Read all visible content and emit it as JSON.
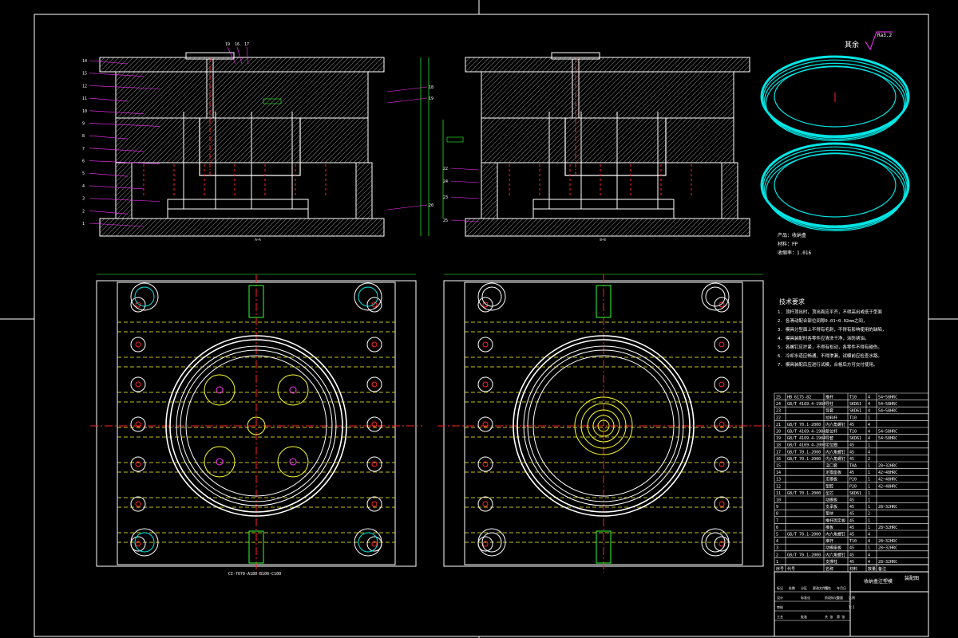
{
  "drawing": {
    "colors": {
      "line": "#ffffff",
      "hatch": "#7a7a7a",
      "leader": "#ff33ff",
      "center": "#ff2222",
      "dim": "#33ff33",
      "cyan": "#00e5e5",
      "yellow": "#ffff33"
    },
    "roughness": "Ra3.2",
    "roughness_prefix": "其余",
    "section_views": {
      "left_caption": "A—A",
      "right_caption": "B—B",
      "callouts_left_top": [
        "19",
        "16",
        "17"
      ],
      "callouts_left_side": [
        "14",
        "15",
        "12",
        "11",
        "10",
        "9",
        "8",
        "7",
        "6",
        "5",
        "4",
        "3",
        "2",
        "1"
      ],
      "callouts_left_right": [
        "18",
        "19",
        "20"
      ],
      "callouts_right_side": [
        "22",
        "24",
        "23",
        "25"
      ]
    },
    "plan_label": "CI-7070-A180-B100-C100",
    "product": {
      "name_label": "产品：",
      "name": "收纳盒",
      "material_label": "材料：",
      "material": "PP",
      "shrink_label": "收缩率：",
      "shrink": "1.016"
    },
    "tech_req": {
      "title": "技术要求",
      "lines": [
        "1. 顶杆顶出时，顶出面应平齐，不得高出或低于型面",
        "2. 各滑动配合部位间隙0.01~0.02mm之间，",
        "3. 模具分型面上不得有毛刺，不得有影响使用的缺陷，",
        "4. 模具装配时各零件应清洗干净，涂防锈油。",
        "5. 各螺钉应拧紧，不得有松动，各零件不得有碰伤。",
        "6. 冷却水道应畅通，不得渗漏，试模前应检查水路。",
        "7. 模具装配后应进行试模，合格后方可交付使用。"
      ]
    },
    "bom": {
      "rows": [
        [
          "25",
          "HB 6175-82",
          "推杆",
          "T10",
          "4",
          "54~58HRC"
        ],
        [
          "24",
          "GB/T 4169.4-1984",
          "导柱",
          "SKD61",
          "4",
          "54~58HRC"
        ],
        [
          "23",
          "",
          "导套",
          "SKD61",
          "4",
          "54~58HRC"
        ],
        [
          "22",
          "",
          "拉料杆",
          "T10",
          "1",
          ""
        ],
        [
          "21",
          "GB/T 70.1-2000",
          "内六角螺钉",
          "45",
          "4",
          ""
        ],
        [
          "20",
          "GB/T 4169.4-1984",
          "复位杆",
          "T10",
          "4",
          "54~58HRC"
        ],
        [
          "19",
          "GB/T 4169.4-1984",
          "导套",
          "SKD61",
          "4",
          "54~58HRC"
        ],
        [
          "18",
          "GB/T 4169.4-2000",
          "定位圈",
          "45",
          "1",
          ""
        ],
        [
          "17",
          "GB/T 70.1-2000",
          "内六角螺钉",
          "45",
          "4",
          ""
        ],
        [
          "16",
          "GB/T 70.1-2000",
          "内六角螺钉",
          "45",
          "2",
          ""
        ],
        [
          "15",
          "",
          "浇口套",
          "T8A",
          "1",
          "28~32HRC"
        ],
        [
          "14",
          "",
          "定模座板",
          "45",
          "1",
          "42~48HRC"
        ],
        [
          "13",
          "",
          "定模板",
          "P20",
          "1",
          "42~48HRC"
        ],
        [
          "12",
          "",
          "型腔",
          "P20",
          "1",
          "42~48HRC"
        ],
        [
          "11",
          "GB/T 70.1-2000",
          "型芯",
          "SKD61",
          "1",
          ""
        ],
        [
          "10",
          "",
          "动模板",
          "45",
          "1",
          ""
        ],
        [
          "9",
          "",
          "支承板",
          "45",
          "1",
          "28~32HRC"
        ],
        [
          "8",
          "",
          "垫块",
          "45",
          "2",
          ""
        ],
        [
          "7",
          "",
          "推杆固定板",
          "45",
          "1",
          ""
        ],
        [
          "6",
          "",
          "推板",
          "45",
          "1",
          "28~32HRC"
        ],
        [
          "5",
          "GB/T 70.1-2000",
          "内六角螺钉",
          "45",
          "4",
          ""
        ],
        [
          "4",
          "",
          "推杆",
          "T10",
          "4",
          "28~32HRC"
        ],
        [
          "3",
          "",
          "动模座板",
          "45",
          "1",
          "28~32HRC"
        ],
        [
          "2",
          "GB/T 70.1-2000",
          "内六角螺钉",
          "45",
          "4",
          ""
        ],
        [
          "1",
          "",
          "支撑柱",
          "45",
          "4",
          "28~32HRC"
        ]
      ],
      "header": [
        "序号",
        "代号",
        "名称",
        "材料",
        "数量",
        "备注"
      ]
    },
    "title_block": {
      "drawing_title": "收纳盒注塑模",
      "school": "装配图",
      "r1": [
        "标记",
        "处数",
        "分区",
        "更改文件号",
        "签名",
        "年月日"
      ],
      "r2": [
        "设计",
        "",
        "标准化",
        "",
        "阶段标记",
        "重量",
        "比例"
      ],
      "r3": [
        "审核",
        "",
        "",
        "",
        "",
        "",
        "1:1"
      ],
      "r4": [
        "工艺",
        "",
        "批准",
        "",
        "共 张",
        "第 张"
      ]
    }
  }
}
